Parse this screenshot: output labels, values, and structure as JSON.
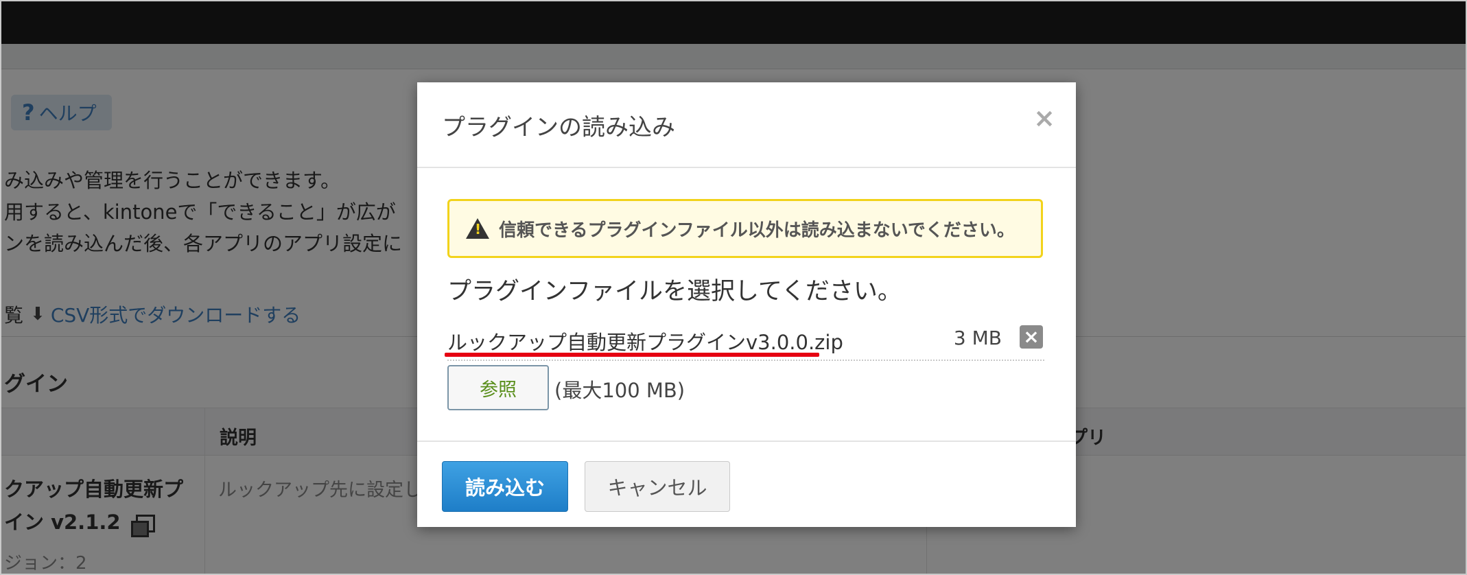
{
  "background": {
    "help_label": "ヘルプ",
    "help_icon": "question-icon",
    "description_lines": [
      "み込みや管理を行うことができます。",
      "用すると、kintoneで「できること」が広が",
      "ンを読み込んだ後、各アプリのアプリ設定に"
    ],
    "list_prefix": "覧",
    "csv_link": "CSV形式でダウンロードする",
    "section_title": "グイン",
    "table_headers": {
      "description": "説明",
      "apps": "プリ"
    },
    "row": {
      "name_line1": "クアップ自動更新プ",
      "name_line2": "イン v2.1.2",
      "description": "ルックアップ先に設定し",
      "version": "ジョン：2"
    }
  },
  "modal": {
    "title": "プラグインの読み込み",
    "close_glyph": "×",
    "warning": "信頼できるプラグインファイル以外は読み込まないでください。",
    "select_label": "プラグインファイルを選択してください。",
    "file": {
      "name": "ルックアップ自動更新プラグインv3.0.0.zip",
      "size": "3 MB",
      "remove_glyph": "×"
    },
    "browse_label": "参照",
    "max_size": "(最大100 MB)",
    "submit_label": "読み込む",
    "cancel_label": "キャンセル"
  },
  "colors": {
    "topbar": "#1c1c1c",
    "link": "#3f7fbf",
    "warning_border": "#f2d31b",
    "warning_bg": "#fffbe3",
    "primary": "#1e7ec8",
    "annotation_underline": "#e60012"
  }
}
